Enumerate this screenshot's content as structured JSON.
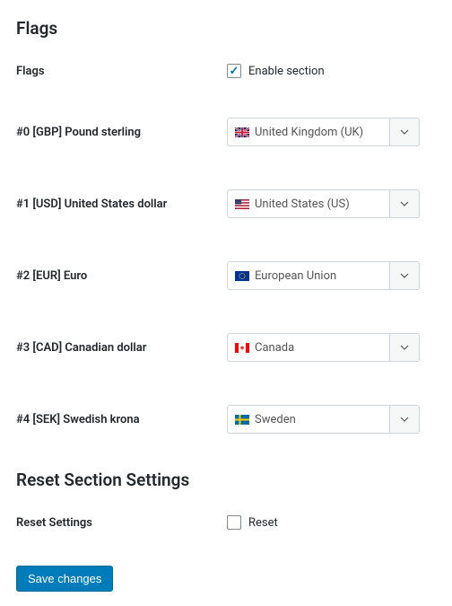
{
  "sections": {
    "flags": {
      "title": "Flags",
      "enable_row": {
        "label": "Flags",
        "checkbox_label": "Enable section",
        "checked": true
      },
      "items": [
        {
          "label": "#0 [GBP] Pound sterling",
          "selected": "United Kingdom (UK)",
          "flag": "uk"
        },
        {
          "label": "#1 [USD] United States dollar",
          "selected": "United States (US)",
          "flag": "us"
        },
        {
          "label": "#2 [EUR] Euro",
          "selected": "European Union",
          "flag": "eu"
        },
        {
          "label": "#3 [CAD] Canadian dollar",
          "selected": "Canada",
          "flag": "ca"
        },
        {
          "label": "#4 [SEK] Swedish krona",
          "selected": "Sweden",
          "flag": "se"
        }
      ]
    },
    "reset": {
      "title": "Reset Section Settings",
      "row": {
        "label": "Reset Settings",
        "checkbox_label": "Reset",
        "checked": false
      }
    }
  },
  "actions": {
    "save": "Save changes"
  }
}
